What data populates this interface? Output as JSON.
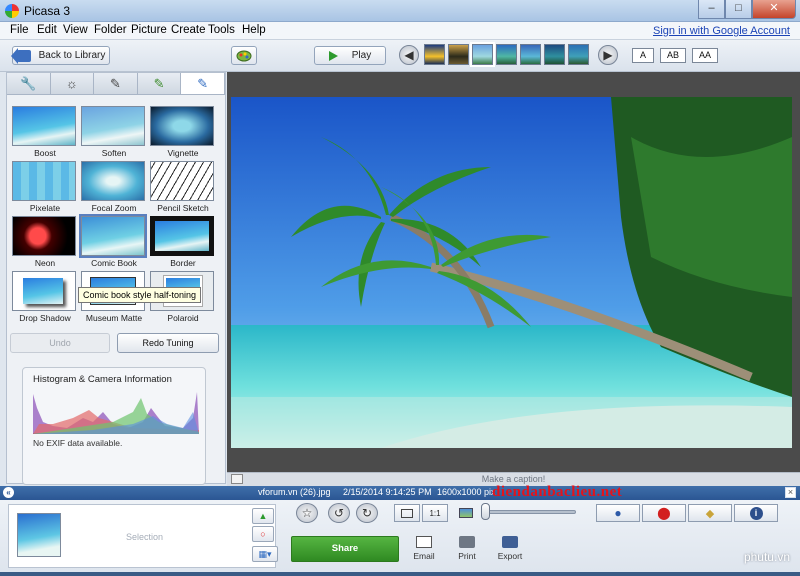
{
  "window": {
    "title": "Picasa 3"
  },
  "menu": {
    "items": [
      "File",
      "Edit",
      "View",
      "Folder",
      "Picture",
      "Create",
      "Tools",
      "Help"
    ],
    "signin": "Sign in with Google Account"
  },
  "toolbar": {
    "back_label": "Back to Library",
    "play_label": "Play",
    "text_sizes": [
      "A",
      "AB",
      "AA"
    ]
  },
  "effects": {
    "items": [
      {
        "label": "Boost"
      },
      {
        "label": "Soften"
      },
      {
        "label": "Vignette"
      },
      {
        "label": "Pixelate"
      },
      {
        "label": "Focal Zoom"
      },
      {
        "label": "Pencil Sketch"
      },
      {
        "label": "Neon"
      },
      {
        "label": "Comic Book"
      },
      {
        "label": "Border"
      },
      {
        "label": "Drop Shadow"
      },
      {
        "label": "Museum Matte"
      },
      {
        "label": "Polaroid"
      }
    ],
    "tooltip": "Comic book style half-toning"
  },
  "tuning": {
    "undo": "Undo",
    "redo": "Redo Tuning"
  },
  "histogram": {
    "title": "Histogram & Camera Information",
    "exif": "No EXIF data available."
  },
  "caption": {
    "placeholder": "Make a caption!"
  },
  "info": {
    "filename": "vforum.vn (26).jpg",
    "datetime": "2/15/2014 9:14:25 PM",
    "dimensions": "1600x1000 pix"
  },
  "watermarks": {
    "forum": "diendanbaclieu.net",
    "site": "phutu.vn"
  },
  "tray": {
    "selection": "Selection",
    "share": "Share",
    "email": "Email",
    "print": "Print",
    "export": "Export"
  }
}
